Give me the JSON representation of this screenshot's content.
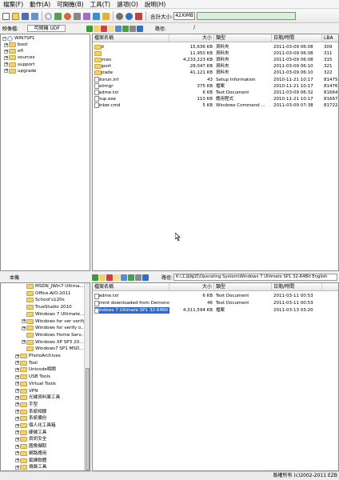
{
  "menu": [
    "檔案(F)",
    "動作(A)",
    "可開機(B)",
    "工具(T)",
    "選項(O)",
    "說明(H)"
  ],
  "toolbar": {
    "total_label": "合計大小:",
    "total_value": "42XIMB"
  },
  "upper": {
    "image_label": "映像檔:",
    "image_type": "可開機 UDF",
    "path_label": "路徑:",
    "path_value": "/",
    "tree": {
      "root": "WIN7SP1",
      "children": [
        "boot",
        "efi",
        "sources",
        "support",
        "upgrade"
      ]
    },
    "columns": [
      "檔案名稱",
      "大小",
      "類型",
      "日期/時間",
      "LBA"
    ],
    "files": [
      {
        "name": "boot",
        "size": "15,636 KB",
        "type": "資料夾",
        "date": "2011-03-09 06:08",
        "lba": "309",
        "kind": "folder"
      },
      {
        "name": "efi",
        "size": "11,950 KB",
        "type": "資料夾",
        "date": "2011-03-09 06:08",
        "lba": "311",
        "kind": "folder"
      },
      {
        "name": "sources",
        "size": "4,233,223 KB",
        "type": "資料夾",
        "date": "2011-03-09 06:08",
        "lba": "315",
        "kind": "folder"
      },
      {
        "name": "support",
        "size": "28,047 KB",
        "type": "資料夾",
        "date": "2011-03-09 06:10",
        "lba": "321",
        "kind": "folder"
      },
      {
        "name": "upgrade",
        "size": "41,121 KB",
        "type": "資料夾",
        "date": "2011-03-09 06:10",
        "lba": "322",
        "kind": "folder"
      },
      {
        "name": "autorun.inf",
        "size": "43",
        "type": "Setup Information",
        "date": "2010-11-21 10:17",
        "lba": "81475",
        "kind": "file"
      },
      {
        "name": "bootmgr",
        "size": "375 KB",
        "type": "檔案",
        "date": "2010-11-21 10:17",
        "lba": "81476",
        "kind": "file"
      },
      {
        "name": "readme.txt",
        "size": "6 KB",
        "type": "Text Document",
        "date": "2011-03-09 06:32",
        "lba": "81664",
        "kind": "file"
      },
      {
        "name": "setup.exe",
        "size": "110 KB",
        "type": "應用程式",
        "date": "2010-11-21 10:17",
        "lba": "81667",
        "kind": "file"
      },
      {
        "name": "thinker.cmd",
        "size": "5 KB",
        "type": "Windows Command ...",
        "date": "2011-03-09 07:38",
        "lba": "81722",
        "kind": "file"
      }
    ]
  },
  "lower": {
    "local_label": "本機",
    "path_label": "路徑:",
    "path_value": "K:\\工具程式\\Operating System\\Windows 7 Ultimate SP1 32-64Bit English",
    "tree": [
      {
        "label": "MSDN_JWin7 Ultima...",
        "indent": 2,
        "exp": ""
      },
      {
        "label": "Office-AIO-2011",
        "indent": 2,
        "exp": ""
      },
      {
        "label": "School's120s",
        "indent": 2,
        "exp": ""
      },
      {
        "label": "TrueStudio 2010",
        "indent": 2,
        "exp": ""
      },
      {
        "label": "Windows 7 Ultimate...",
        "indent": 2,
        "exp": ""
      },
      {
        "label": "Windows for ver verify...",
        "indent": 2,
        "exp": "+"
      },
      {
        "label": "Windows for verify o...",
        "indent": 2,
        "exp": "+"
      },
      {
        "label": "Windows Home Serv...",
        "indent": 2,
        "exp": ""
      },
      {
        "label": "Windows XP SP3 20...",
        "indent": 2,
        "exp": "+"
      },
      {
        "label": "Windows7 SP1 MSD...",
        "indent": 2,
        "exp": ""
      },
      {
        "label": "PhotoArchives",
        "indent": 1,
        "exp": "+"
      },
      {
        "label": "Tool",
        "indent": 1,
        "exp": "+"
      },
      {
        "label": "Unicode相關",
        "indent": 1,
        "exp": "+"
      },
      {
        "label": "USB Tools",
        "indent": 1,
        "exp": "+"
      },
      {
        "label": "Virtual Tools",
        "indent": 1,
        "exp": "+"
      },
      {
        "label": "VPN",
        "indent": 1,
        "exp": "+"
      },
      {
        "label": "光碟資料庫工具",
        "indent": 1,
        "exp": "+"
      },
      {
        "label": "手型",
        "indent": 1,
        "exp": "+"
      },
      {
        "label": "系統相關",
        "indent": 1,
        "exp": "+"
      },
      {
        "label": "系統備份",
        "indent": 1,
        "exp": "+"
      },
      {
        "label": "個人化工具箱",
        "indent": 1,
        "exp": "+"
      },
      {
        "label": "硬碟工具",
        "indent": 1,
        "exp": "+"
      },
      {
        "label": "資訊安全",
        "indent": 1,
        "exp": "+"
      },
      {
        "label": "圖像擷取",
        "indent": 1,
        "exp": "+"
      },
      {
        "label": "網路應用",
        "indent": 1,
        "exp": "+"
      },
      {
        "label": "編譯軟體",
        "indent": 1,
        "exp": "+"
      },
      {
        "label": "燒錄工具",
        "indent": 1,
        "exp": "+"
      }
    ],
    "columns": [
      "檔案名稱",
      "大小",
      "類型",
      "日期/時間"
    ],
    "files": [
      {
        "name": "readme.txt",
        "size": "6 KB",
        "type": "Text Document",
        "date": "2011-03-11 00:53",
        "selected": false
      },
      {
        "name": "Torrent downloaded from Demonoi...",
        "size": "46",
        "type": "Text Document",
        "date": "2011-03-11 00:53",
        "selected": false
      },
      {
        "name": "Windows 7 Ultimate SP1 32-64Bit ...",
        "size": "4,311,594 KB",
        "type": "檔案",
        "date": "2011-03-13 03:20",
        "selected": true
      }
    ]
  },
  "status": {
    "copyright": "版權所有 (c)2002-2011 EZB"
  }
}
